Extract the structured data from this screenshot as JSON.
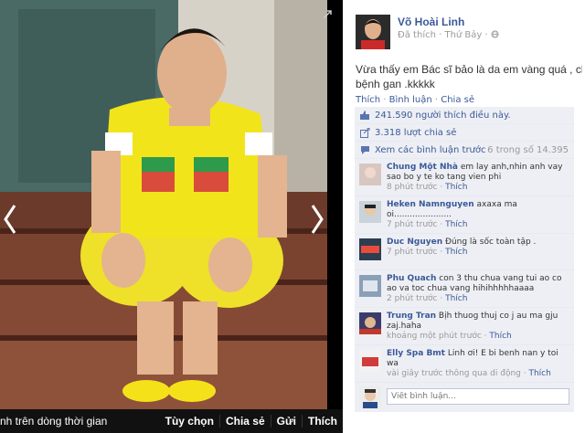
{
  "bottom_bar": {
    "left_text": "nh trên dòng thời gian",
    "options_label": "Tùy chọn",
    "share_label": "Chia sẻ",
    "send_label": "Gửi",
    "like_label": "Thích"
  },
  "post": {
    "author": "Võ Hoài Linh",
    "meta": "Đã thích · Thứ Bảy ·",
    "status_line1": "Vừa thấy em Bác sĩ bảo là da em vàng quá , chắc em bị",
    "status_line2": "bệnh gan .kkkkk",
    "action_like": "Thích",
    "action_comment": "Bình luận",
    "action_share": "Chia sẻ"
  },
  "feedback": {
    "likes_text": "241.590 người thích điều này.",
    "shares_text": "3.318 lượt chia sẻ",
    "view_previous": "Xem các bình luận trước",
    "count_text": "6 trong số 14.395"
  },
  "comments": [
    {
      "name": "Chung Một Nhà",
      "text": " em lay anh,nhin anh vay sao bo y te ko tang vien phi",
      "time": "8 phút trước ·",
      "like": "Thích"
    },
    {
      "name": "Heken Namnguyen",
      "text": " axaxa ma oi......................",
      "time": "7 phút trước ·",
      "like": "Thích"
    },
    {
      "name": "Duc Nguyen",
      "text": " Đúng là sốc toàn tập .",
      "time": "7 phút trước ·",
      "like": "Thích"
    },
    {
      "name": "Phu Quach",
      "text": " con 3 thu chua vang tui ao co ao va toc chua vang hihihhhhhaaaa",
      "time": "2 phút trước ·",
      "like": "Thích"
    },
    {
      "name": "Trung Tran",
      "text": " Bịh thuog thuj co j au ma gju zaj.haha",
      "time": "khoảng một phút trước ·",
      "like": "Thích"
    },
    {
      "name": "Elly Spa Bmt",
      "text": " Linh ơi! E bi benh nan y toi wa",
      "time": "vài giây trước thông qua di động ·",
      "like": "Thích"
    }
  ],
  "write_comment": {
    "placeholder": "Viết bình luận..."
  },
  "colors": {
    "link": "#3b5998",
    "panel_bg": "#edeff4",
    "shirt": "#f2e41a"
  }
}
